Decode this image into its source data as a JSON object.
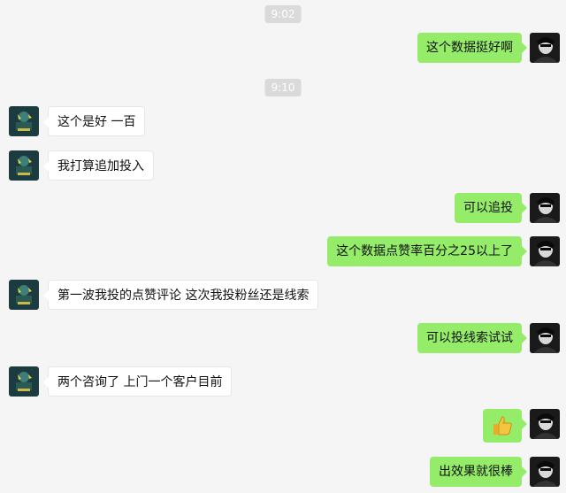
{
  "timestamps": [
    "9:02",
    "9:10"
  ],
  "messages": {
    "m1": "这个数据挺好啊",
    "m2": "这个是好 一百",
    "m3": "我打算追加投入",
    "m4": "可以追投",
    "m5": "这个数据点赞率百分之25以上了",
    "m6": "第一波我投的点赞评论 这次我投粉丝还是线索",
    "m7": "可以投线索试试",
    "m8": "两个咨询了 上门一个客户目前",
    "m9": "thumbs-up-emoji",
    "m10": "出效果就很棒"
  },
  "colors": {
    "background": "#f5f5f5",
    "outgoing_bubble": "#95ec69",
    "incoming_bubble": "#ffffff",
    "timestamp_bg": "#dadada"
  }
}
